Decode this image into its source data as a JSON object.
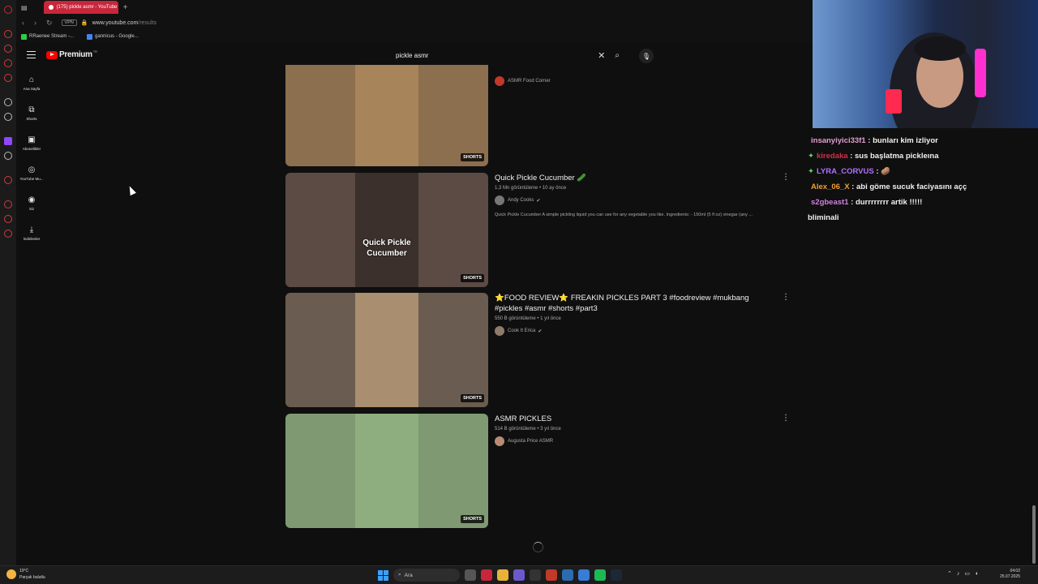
{
  "browser": {
    "tab_title": "(175) pickle asmr - YouTube",
    "url_host": "www.youtube.com",
    "url_path": "/results",
    "vpn_label": "VPN",
    "bookmarks": [
      {
        "label": "RRaenee Stream -...",
        "color": "#2ecc40"
      },
      {
        "label": "gannicus - Google...",
        "color": "#4285f4"
      }
    ]
  },
  "youtube": {
    "logo_text": "Premium",
    "region": "TR",
    "search_query": "pickle asmr",
    "sidebar": [
      {
        "icon": "home-icon",
        "glyph": "⌂",
        "label": "Ana Sayfa"
      },
      {
        "icon": "shorts-icon",
        "glyph": "⧉",
        "label": "Shorts"
      },
      {
        "icon": "subscriptions-icon",
        "glyph": "▣",
        "label": "Abonelikler"
      },
      {
        "icon": "youtube-music-icon",
        "glyph": "◎",
        "label": "YouTube Mu..."
      },
      {
        "icon": "you-icon",
        "glyph": "◉",
        "label": "Siz"
      },
      {
        "icon": "downloads-icon",
        "glyph": "⤓",
        "label": "İndirilenler"
      }
    ],
    "results": [
      {
        "title": "",
        "sub": "",
        "channel": "ASMR Food Corner",
        "verified": false,
        "description": "",
        "badge": "SHORTS",
        "overlay": "",
        "thumb_bg": "#8b6f4e",
        "thumb_inner": "#a8845a",
        "avatar_color": "#c0392b",
        "partial": true
      },
      {
        "title": "Quick Pickle Cucumber 🥒",
        "sub": "1,3 Mn görüntüleme • 10 ay önce",
        "channel": "Andy Cooks",
        "verified": true,
        "description": "Quick Pickle Cucumber A simple pickling liquid you can use for any vegetable you like. Ingredients: - 150ml (5 fl oz) vinegar (any ...",
        "badge": "SHORTS",
        "overlay": "Quick Pickle Cucumber",
        "thumb_bg": "#5b4b44",
        "thumb_inner": "#3b302c",
        "avatar_color": "#777777",
        "partial": false
      },
      {
        "title": "⭐FOOD REVIEW⭐ FREAKIN PICKLES PART 3 #foodreview #mukbang #pickles #asmr #shorts #part3",
        "sub": "550 B görüntüleme • 1 yıl önce",
        "channel": "Cook It Erica",
        "verified": true,
        "description": "",
        "badge": "SHORTS",
        "overlay": "",
        "thumb_bg": "#6a5c50",
        "thumb_inner": "#a98f6f",
        "avatar_color": "#8e7b6a",
        "partial": false
      },
      {
        "title": "ASMR PICKLES",
        "sub": "514 B görüntüleme • 3 yıl önce",
        "channel": "Augusta Price ASMR",
        "verified": false,
        "description": "",
        "badge": "SHORTS",
        "overlay": "",
        "thumb_bg": "#7f9a72",
        "thumb_inner": "#8fae7f",
        "avatar_color": "#b88b73",
        "partial": false
      }
    ]
  },
  "chat": [
    {
      "name": "insanyiyici33f1",
      "text": "bunları kim izliyor",
      "color": "#e0a0d0",
      "gem": false
    },
    {
      "name": "kiredaka",
      "text": "sus başlatma pickleına",
      "color": "#d0304a",
      "gem": true
    },
    {
      "name": "LYRA_CORVUS",
      "text": "🥔",
      "color": "#b070ff",
      "gem": true
    },
    {
      "name": "Alex_06_X",
      "text": "abi göme sucuk faciyasını açç",
      "color": "#f0a030",
      "gem": false
    },
    {
      "name": "s2gbeast1",
      "text": "durrrrrrrr artik !!!!!",
      "color": "#d080e0",
      "gem": false
    }
  ],
  "chat_extra": "bliminali",
  "taskbar": {
    "temp": "19°C",
    "weather": "Parçalı bulutlu",
    "search": "Ara",
    "time": "04:02",
    "date": "25.07.2025"
  }
}
